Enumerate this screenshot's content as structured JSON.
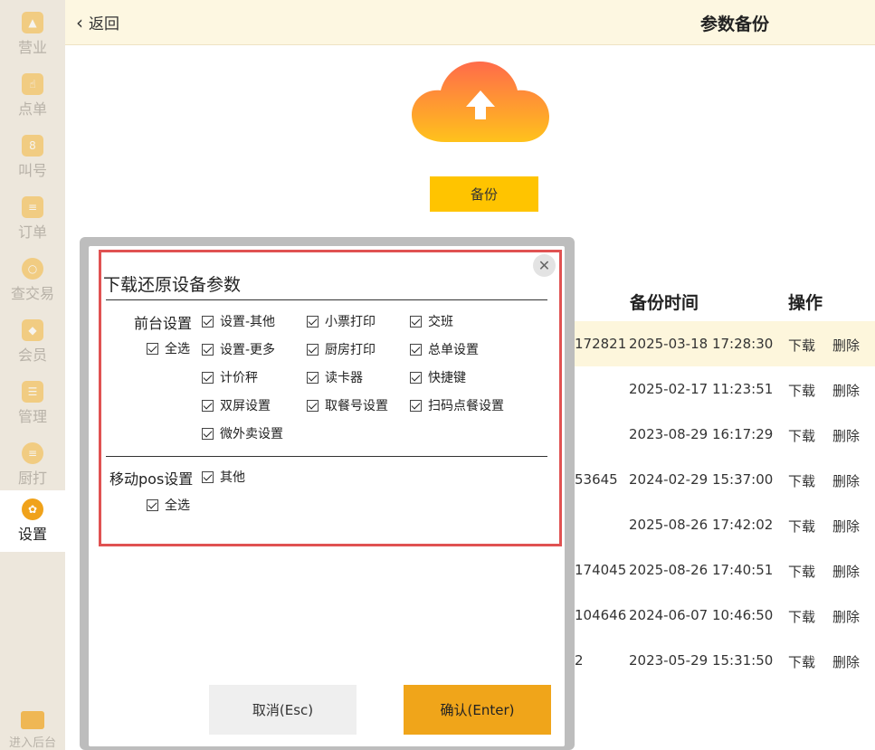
{
  "sidebar": {
    "items": [
      {
        "label": "营业",
        "icon": "chart-icon"
      },
      {
        "label": "点单",
        "icon": "hand-pointer-icon"
      },
      {
        "label": "叫号",
        "icon": "number-icon"
      },
      {
        "label": "订单",
        "icon": "order-list-icon"
      },
      {
        "label": "查交易",
        "icon": "search-icon"
      },
      {
        "label": "会员",
        "icon": "diamond-icon"
      },
      {
        "label": "管理",
        "icon": "manage-list-icon"
      },
      {
        "label": "厨打",
        "icon": "kitchen-print-icon"
      },
      {
        "label": "设置",
        "icon": "gear-icon"
      }
    ],
    "active_index": 8,
    "bottom_label": "进入后台"
  },
  "header": {
    "back_label": "返回",
    "title": "参数备份"
  },
  "backup_button": "备份",
  "table": {
    "headers": {
      "time": "备份时间",
      "action": "操作"
    },
    "action_download": "下载",
    "action_delete": "删除",
    "rows": [
      {
        "id": "172821",
        "time": "2025-03-18 17:28:30"
      },
      {
        "id": "",
        "time": "2025-02-17 11:23:51"
      },
      {
        "id": "",
        "time": "2023-08-29 16:17:29"
      },
      {
        "id": "53645",
        "time": "2024-02-29 15:37:00"
      },
      {
        "id": "",
        "time": "2025-08-26 17:42:02"
      },
      {
        "id": "174045",
        "time": "2025-08-26 17:40:51"
      },
      {
        "id": "104646",
        "time": "2024-06-07 10:46:50"
      },
      {
        "id": "2",
        "time": "2023-05-29 15:31:50"
      }
    ]
  },
  "dialog": {
    "title": "下载还原设备参数",
    "close_symbol": "✕",
    "front_section": {
      "label": "前台设置",
      "select_all": "全选",
      "options": [
        "设置-其他",
        "小票打印",
        "交班",
        "设置-更多",
        "厨房打印",
        "总单设置",
        "计价秤",
        "读卡器",
        "快捷键",
        "双屏设置",
        "取餐号设置",
        "扫码点餐设置",
        "微外卖设置"
      ]
    },
    "mobile_section": {
      "label": "移动pos设置",
      "select_all": "全选",
      "options": [
        "其他"
      ]
    },
    "cancel_label": "取消(Esc)",
    "confirm_label": "确认(Enter)"
  },
  "colors": {
    "accent": "#f0a51a",
    "highlight_border": "#e05252",
    "header_bg": "#fdf7e1"
  }
}
